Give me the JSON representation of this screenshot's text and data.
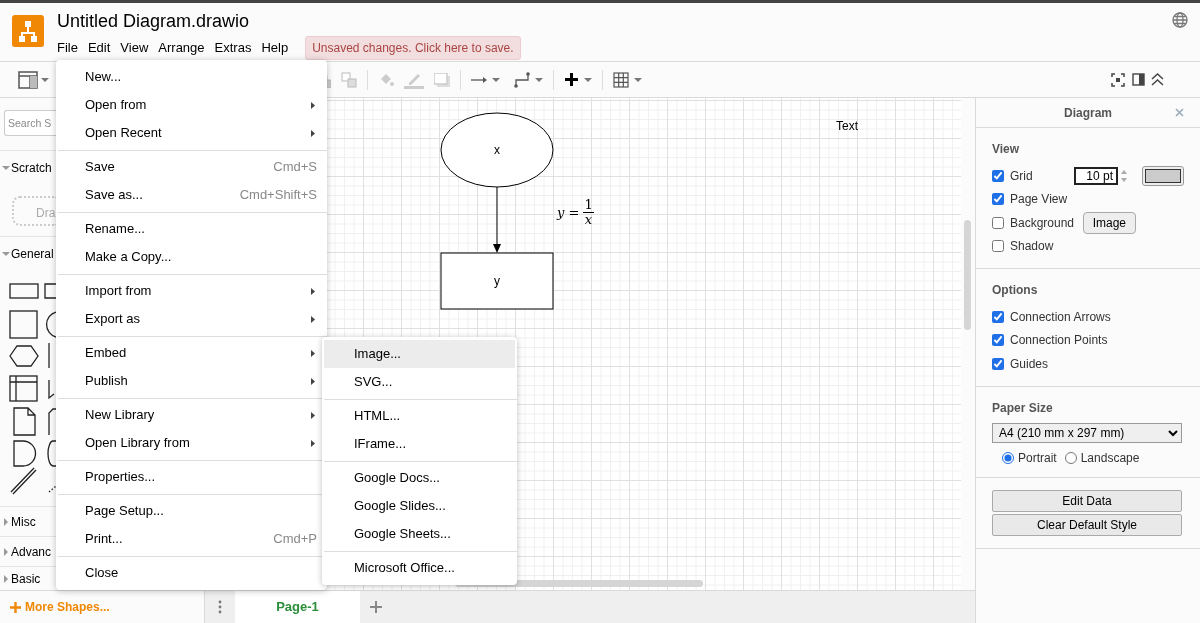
{
  "app": {
    "title": "Untitled Diagram.drawio",
    "menus": [
      "File",
      "Edit",
      "View",
      "Arrange",
      "Extras",
      "Help"
    ],
    "unsaved_notice": "Unsaved changes. Click here to save."
  },
  "sidebar": {
    "search": {
      "placeholder": "Search S"
    },
    "sections": [
      {
        "label": "Scratch",
        "expanded": true,
        "kind": "scratch",
        "hint": "Dra"
      },
      {
        "label": "General",
        "expanded": true,
        "kind": "shapes"
      },
      {
        "label": "Misc",
        "expanded": false,
        "kind": "plain"
      },
      {
        "label": "Advanc",
        "expanded": false,
        "kind": "plain"
      },
      {
        "label": "Basic",
        "expanded": false,
        "kind": "plain"
      }
    ],
    "more_shapes": "More Shapes..."
  },
  "canvas": {
    "shapes": [
      {
        "kind": "ellipse",
        "label": "x"
      },
      {
        "kind": "rect",
        "label": "y"
      }
    ],
    "formula": {
      "lhs": "*y* =",
      "numerator": "1",
      "denominator": "*x*"
    },
    "text_label": "Text"
  },
  "file_menu": {
    "groups": [
      [
        {
          "label": "New...",
          "submenu": false
        },
        {
          "label": "Open from",
          "submenu": true
        },
        {
          "label": "Open Recent",
          "submenu": true
        }
      ],
      [
        {
          "label": "Save",
          "shortcut": "Cmd+S",
          "submenu": false
        },
        {
          "label": "Save as...",
          "shortcut": "Cmd+Shift+S",
          "submenu": false
        }
      ],
      [
        {
          "label": "Rename...",
          "submenu": false
        },
        {
          "label": "Make a Copy...",
          "submenu": false
        }
      ],
      [
        {
          "label": "Import from",
          "submenu": true
        },
        {
          "label": "Export as",
          "submenu": true
        }
      ],
      [
        {
          "label": "Embed",
          "submenu": true
        },
        {
          "label": "Publish",
          "submenu": true
        }
      ],
      [
        {
          "label": "New Library",
          "submenu": true
        },
        {
          "label": "Open Library from",
          "submenu": true
        }
      ],
      [
        {
          "label": "Properties...",
          "submenu": false
        }
      ],
      [
        {
          "label": "Page Setup...",
          "submenu": false
        },
        {
          "label": "Print...",
          "shortcut": "Cmd+P",
          "submenu": false
        }
      ],
      [
        {
          "label": "Close",
          "submenu": false
        }
      ]
    ]
  },
  "embed_menu": {
    "groups": [
      [
        {
          "label": "Image...",
          "selected": true
        },
        {
          "label": "SVG...",
          "selected": false
        }
      ],
      [
        {
          "label": "HTML...",
          "selected": false
        },
        {
          "label": "IFrame...",
          "selected": false
        }
      ],
      [
        {
          "label": "Google Docs...",
          "selected": false
        },
        {
          "label": "Google Slides...",
          "selected": false
        },
        {
          "label": "Google Sheets...",
          "selected": false
        }
      ],
      [
        {
          "label": "Microsoft Office...",
          "selected": false
        }
      ]
    ]
  },
  "format_panel": {
    "title": "Diagram",
    "view": {
      "heading": "View",
      "items": [
        {
          "label": "Grid",
          "checked": true,
          "size": "10 pt"
        },
        {
          "label": "Page View",
          "checked": true
        },
        {
          "label": "Background",
          "checked": false,
          "button": "Image"
        },
        {
          "label": "Shadow",
          "checked": false
        }
      ]
    },
    "options": {
      "heading": "Options",
      "items": [
        {
          "label": "Connection Arrows",
          "checked": true
        },
        {
          "label": "Connection Points",
          "checked": true
        },
        {
          "label": "Guides",
          "checked": true
        }
      ]
    },
    "paper": {
      "heading": "Paper Size",
      "size": "A4 (210 mm x 297 mm)",
      "orientations": [
        {
          "label": "Portrait",
          "selected": true
        },
        {
          "label": "Landscape",
          "selected": false
        }
      ]
    },
    "buttons": [
      "Edit Data",
      "Clear Default Style"
    ]
  },
  "pages": [
    {
      "label": "Page-1",
      "selected": true
    }
  ]
}
